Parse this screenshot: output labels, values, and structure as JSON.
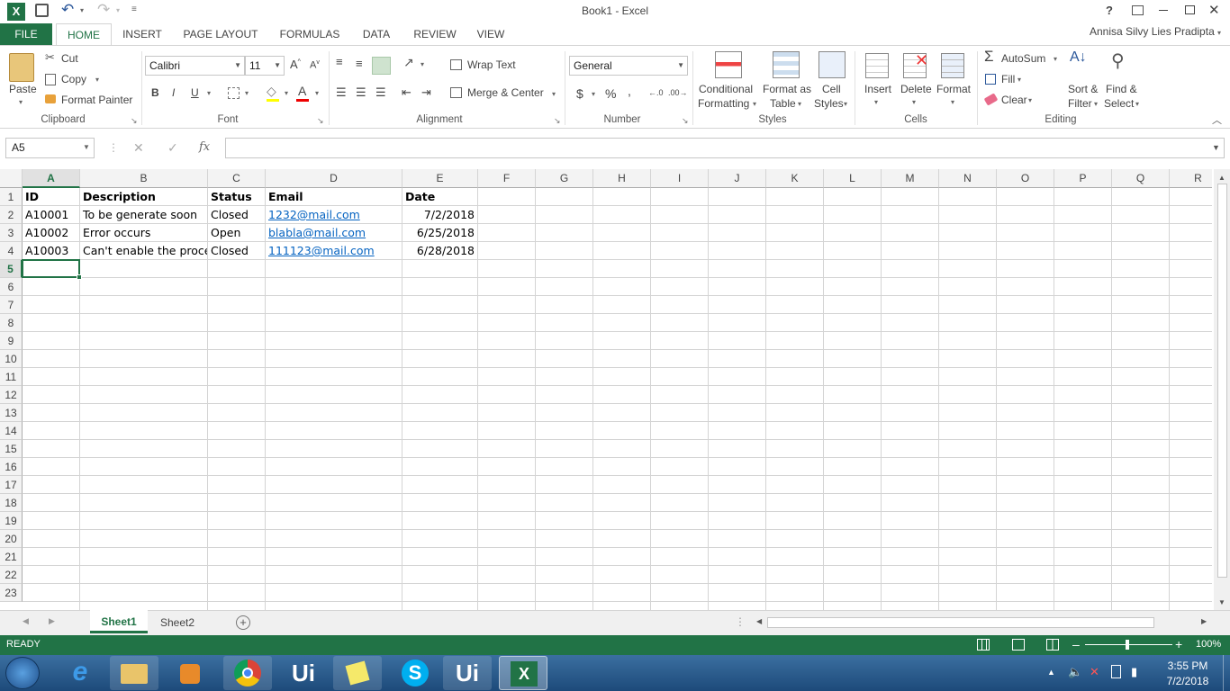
{
  "window": {
    "title": "Book1 - Excel",
    "user": "Annisa Silvy Lies Pradipta"
  },
  "ribbon_tabs": [
    "FILE",
    "HOME",
    "INSERT",
    "PAGE LAYOUT",
    "FORMULAS",
    "DATA",
    "REVIEW",
    "VIEW"
  ],
  "clipboard": {
    "paste": "Paste",
    "cut": "Cut",
    "copy": "Copy",
    "format_painter": "Format Painter",
    "label": "Clipboard"
  },
  "font": {
    "name": "Calibri",
    "size": "11",
    "bold": "B",
    "italic": "I",
    "underline": "U",
    "label": "Font"
  },
  "alignment": {
    "wrap": "Wrap Text",
    "merge": "Merge & Center",
    "label": "Alignment"
  },
  "number": {
    "format": "General",
    "currency": "$",
    "percent": "%",
    "comma": ",",
    "label": "Number"
  },
  "styles": {
    "cond1": "Conditional",
    "cond2": "Formatting",
    "fmt1": "Format as",
    "fmt2": "Table",
    "cell1": "Cell",
    "cell2": "Styles",
    "label": "Styles"
  },
  "cells": {
    "insert": "Insert",
    "delete": "Delete",
    "format": "Format",
    "label": "Cells"
  },
  "editing": {
    "autosum": "AutoSum",
    "fill": "Fill",
    "clear": "Clear",
    "sort1": "Sort &",
    "sort2": "Filter",
    "find1": "Find &",
    "find2": "Select",
    "label": "Editing"
  },
  "formula_bar": {
    "name_box": "A5",
    "fx": "fx",
    "value": ""
  },
  "columns": [
    "A",
    "B",
    "C",
    "D",
    "E",
    "F",
    "G",
    "H",
    "I",
    "J",
    "K",
    "L",
    "M",
    "N",
    "O",
    "P",
    "Q",
    "R"
  ],
  "rows": [
    "1",
    "2",
    "3",
    "4",
    "5",
    "6",
    "7",
    "8",
    "9",
    "10",
    "11",
    "12",
    "13",
    "14",
    "15",
    "16",
    "17",
    "18",
    "19",
    "20",
    "21",
    "22",
    "23"
  ],
  "table": {
    "headers": [
      "ID",
      "Description",
      "Status",
      "Email",
      "Date"
    ],
    "data": [
      [
        "A10001",
        "To be generate soon",
        "Closed",
        "1232@mail.com",
        "7/2/2018"
      ],
      [
        "A10002",
        "Error occurs",
        "Open",
        "blabla@mail.com",
        "6/25/2018"
      ],
      [
        "A10003",
        "Can't enable the proce",
        "Closed",
        "111123@mail.com",
        "6/28/2018"
      ]
    ]
  },
  "sheets": [
    "Sheet1",
    "Sheet2"
  ],
  "status": {
    "ready": "READY",
    "zoom": "100%"
  },
  "taskbar": {
    "time": "3:55 PM",
    "date": "7/2/2018"
  },
  "colors": {
    "excel_green": "#217346",
    "link": "#0563c1"
  }
}
